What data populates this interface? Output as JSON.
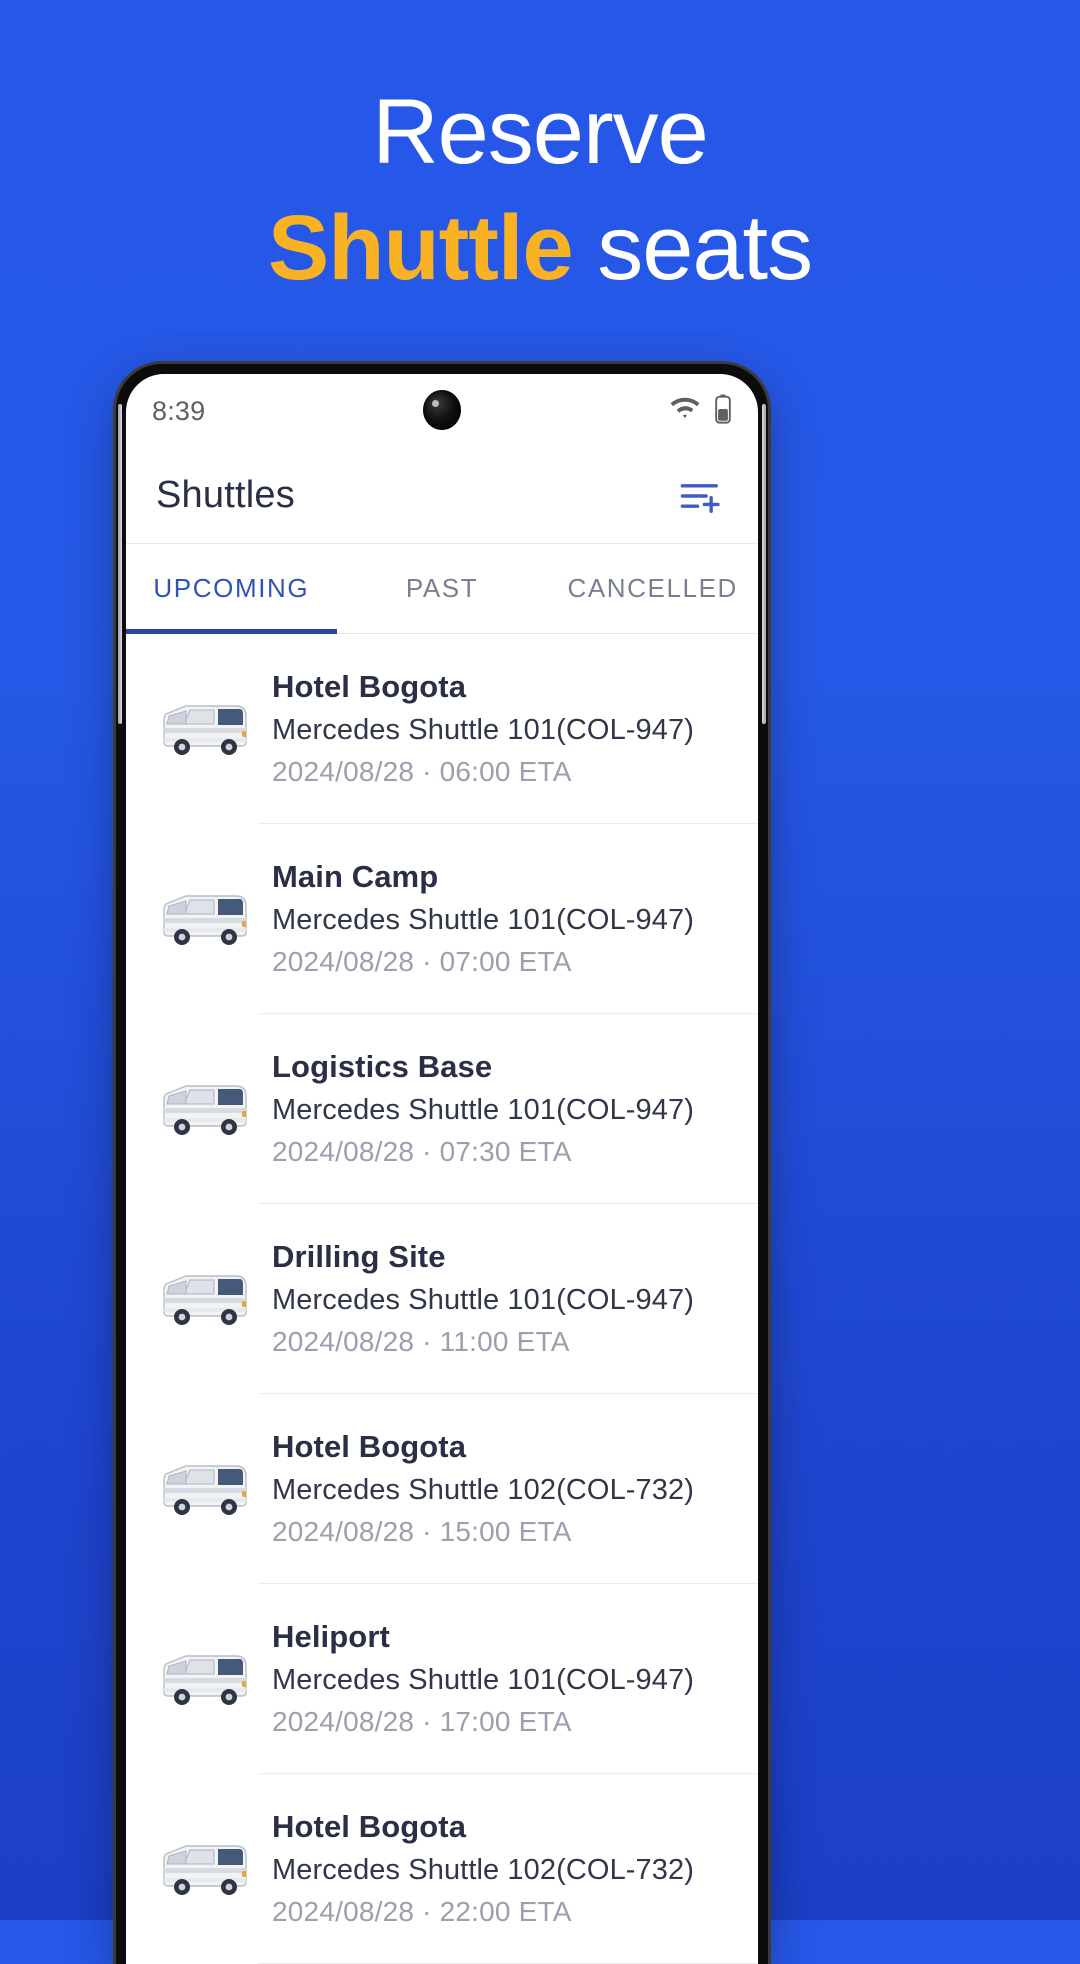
{
  "promo": {
    "line1": "Reserve",
    "line2_accent": "Shuttle",
    "line2_rest": " seats",
    "bg_color": "#2657E8",
    "accent_color": "#F9B223"
  },
  "status_bar": {
    "time": "8:39",
    "wifi_icon": "wifi-icon",
    "battery_icon": "battery-icon"
  },
  "app_bar": {
    "title": "Shuttles",
    "filter_icon": "filter-add-icon"
  },
  "tabs": [
    {
      "label": "UPCOMING",
      "active": true
    },
    {
      "label": "PAST",
      "active": false
    },
    {
      "label": "CANCELLED",
      "active": false
    }
  ],
  "shuttles": [
    {
      "icon": "bus-icon",
      "destination": "Hotel Bogota",
      "vehicle": "Mercedes Shuttle 101(COL-947)",
      "schedule": "2024/08/28 · 06:00 ETA"
    },
    {
      "icon": "bus-icon",
      "destination": "Main Camp",
      "vehicle": "Mercedes Shuttle 101(COL-947)",
      "schedule": "2024/08/28 · 07:00 ETA"
    },
    {
      "icon": "bus-icon",
      "destination": "Logistics Base",
      "vehicle": "Mercedes Shuttle 101(COL-947)",
      "schedule": "2024/08/28 · 07:30 ETA"
    },
    {
      "icon": "bus-icon",
      "destination": "Drilling Site",
      "vehicle": "Mercedes Shuttle 101(COL-947)",
      "schedule": "2024/08/28 · 11:00 ETA"
    },
    {
      "icon": "bus-icon",
      "destination": "Hotel Bogota",
      "vehicle": "Mercedes Shuttle 102(COL-732)",
      "schedule": "2024/08/28 · 15:00 ETA"
    },
    {
      "icon": "bus-icon",
      "destination": "Heliport",
      "vehicle": "Mercedes Shuttle 101(COL-947)",
      "schedule": "2024/08/28 · 17:00 ETA"
    },
    {
      "icon": "bus-icon",
      "destination": "Hotel Bogota",
      "vehicle": "Mercedes Shuttle 102(COL-732)",
      "schedule": "2024/08/28 · 22:00 ETA"
    }
  ]
}
